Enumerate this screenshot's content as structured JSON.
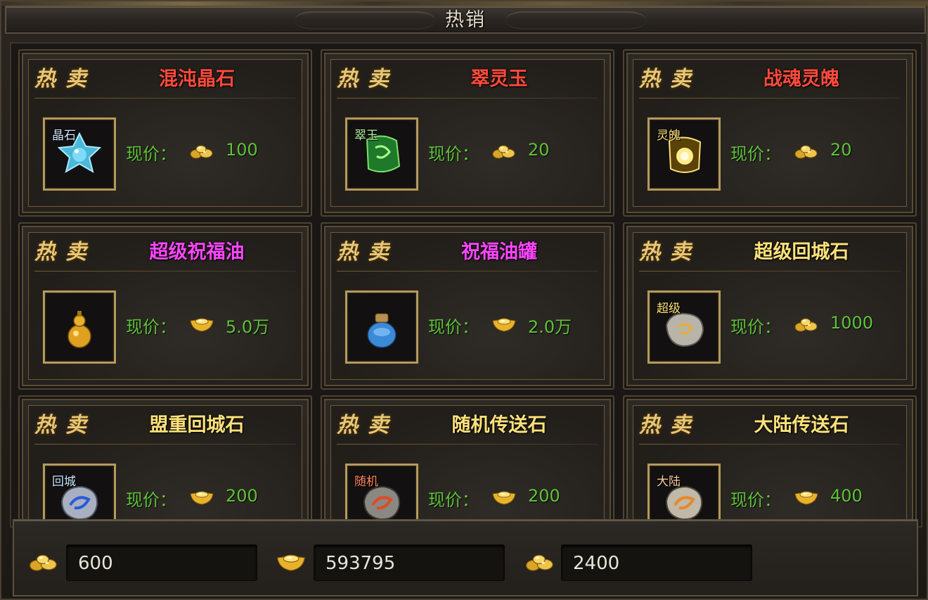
{
  "window": {
    "title": "热销"
  },
  "shop": {
    "hot_label": "热卖",
    "price_label": "现价：",
    "items": [
      {
        "name": "混沌晶石",
        "name_color": "#ff4a3c",
        "slot_tag": "晶石",
        "slot_tag_color": "#cfe8ff",
        "art": "crystal-star",
        "currency": "gold-nugget-icon",
        "price": "100"
      },
      {
        "name": "翠灵玉",
        "name_color": "#ff4a3c",
        "slot_tag": "翠玉",
        "slot_tag_color": "#b8f0a0",
        "art": "green-jade",
        "currency": "gold-nugget-icon",
        "price": "20"
      },
      {
        "name": "战魂灵魄",
        "name_color": "#ff4a3c",
        "slot_tag": "灵魄",
        "slot_tag_color": "#ffe27a",
        "art": "gold-soul",
        "currency": "gold-nugget-icon",
        "price": "20"
      },
      {
        "name": "超级祝福油",
        "name_color": "#ff46ff",
        "slot_tag": "",
        "slot_tag_color": "#ffffff",
        "art": "gourd",
        "currency": "gold-ingot-icon",
        "price": "5.0万"
      },
      {
        "name": "祝福油罐",
        "name_color": "#ff46ff",
        "slot_tag": "",
        "slot_tag_color": "#ffffff",
        "art": "blue-jar",
        "currency": "gold-ingot-icon",
        "price": "2.0万"
      },
      {
        "name": "超级回城石",
        "name_color": "#ffe27a",
        "slot_tag": "超级",
        "slot_tag_color": "#ffe27a",
        "art": "gray-stone",
        "currency": "gold-nugget-icon",
        "price": "1000"
      },
      {
        "name": "盟重回城石",
        "name_color": "#ffe27a",
        "slot_tag": "回城",
        "slot_tag_color": "#cfe8ff",
        "art": "blue-stone",
        "currency": "gold-ingot-icon",
        "price": "200"
      },
      {
        "name": "随机传送石",
        "name_color": "#ffe27a",
        "slot_tag": "随机",
        "slot_tag_color": "#ff8a5c",
        "art": "red-stone",
        "currency": "gold-ingot-icon",
        "price": "200"
      },
      {
        "name": "大陆传送石",
        "name_color": "#ffe27a",
        "slot_tag": "大陆",
        "slot_tag_color": "#ffd0a0",
        "art": "orange-stone",
        "currency": "gold-ingot-icon",
        "price": "400"
      }
    ]
  },
  "balances": [
    {
      "icon": "gold-nugget-icon",
      "value": "600"
    },
    {
      "icon": "gold-ingot-icon",
      "value": "593795"
    },
    {
      "icon": "gold-nugget-icon",
      "value": "2400"
    }
  ],
  "colors": {
    "price_green": "#5fc33a",
    "hot_gold": "#e8c774",
    "frame_gold": "#b49a5c"
  }
}
